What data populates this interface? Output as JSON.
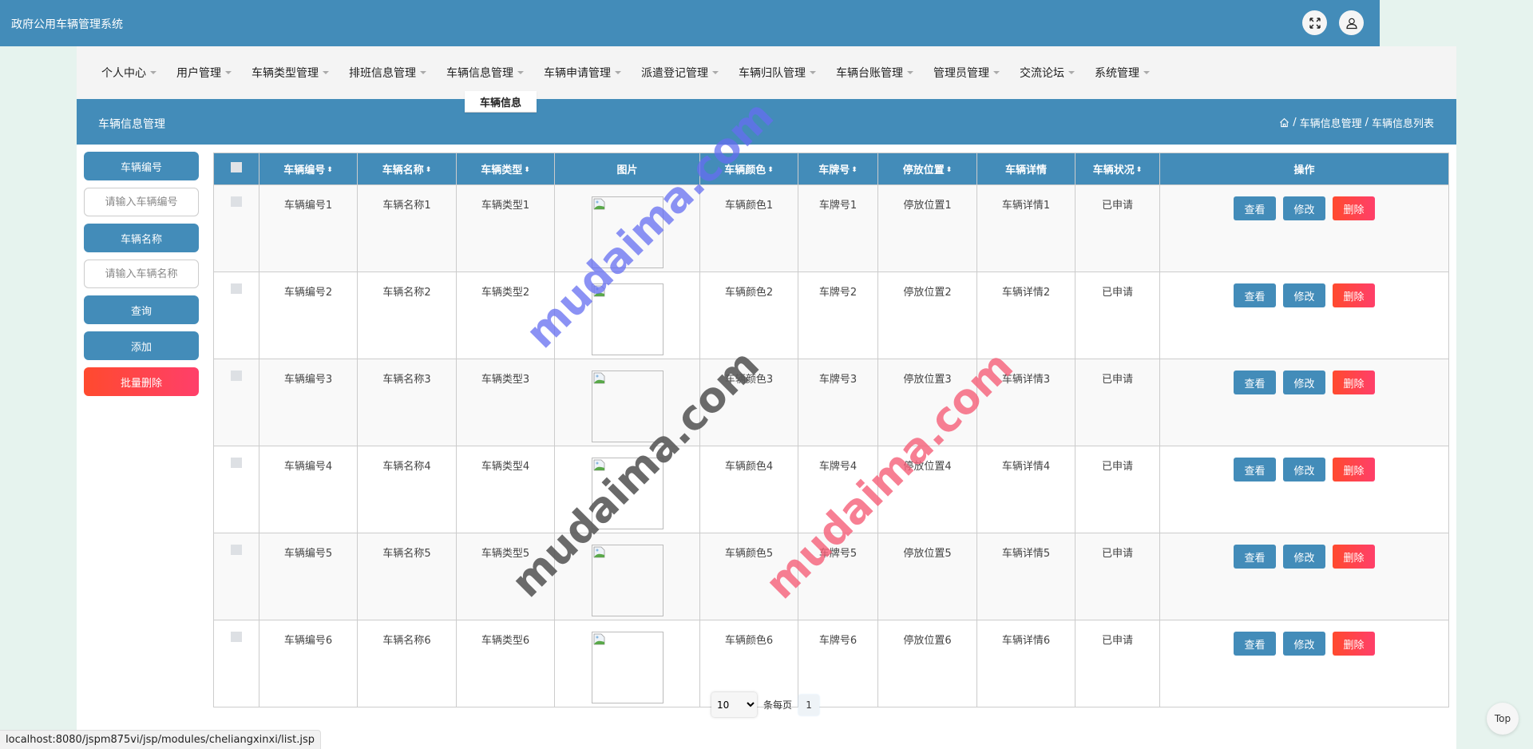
{
  "app": {
    "title": "政府公用车辆管理系统",
    "icons": {
      "fullscreen": "fullscreen-icon",
      "user": "user-icon"
    }
  },
  "nav": {
    "items": [
      {
        "label": "个人中心"
      },
      {
        "label": "用户管理"
      },
      {
        "label": "车辆类型管理"
      },
      {
        "label": "排班信息管理"
      },
      {
        "label": "车辆信息管理"
      },
      {
        "label": "车辆申请管理"
      },
      {
        "label": "派遣登记管理"
      },
      {
        "label": "车辆归队管理"
      },
      {
        "label": "车辆台账管理"
      },
      {
        "label": "管理员管理"
      },
      {
        "label": "交流论坛"
      },
      {
        "label": "系统管理"
      }
    ],
    "open_dropdown": {
      "parent": "车辆信息管理",
      "items": [
        "车辆信息"
      ]
    }
  },
  "band": {
    "page_title": "车辆信息管理",
    "breadcrumb": [
      "车辆信息管理",
      "车辆信息列表"
    ],
    "separator": "/"
  },
  "search": {
    "field1_label": "车辆编号",
    "field1_placeholder": "请输入车辆编号",
    "field1_value": "",
    "field2_label": "车辆名称",
    "field2_placeholder": "请输入车辆名称",
    "field2_value": "",
    "query_label": "查询",
    "add_label": "添加",
    "batch_delete_label": "批量删除"
  },
  "table": {
    "columns": [
      {
        "label": "",
        "type": "checkbox"
      },
      {
        "label": "车辆编号",
        "sortable": true
      },
      {
        "label": "车辆名称",
        "sortable": true
      },
      {
        "label": "车辆类型",
        "sortable": true
      },
      {
        "label": "图片",
        "sortable": false
      },
      {
        "label": "车辆颜色",
        "sortable": true
      },
      {
        "label": "车牌号",
        "sortable": true
      },
      {
        "label": "停放位置",
        "sortable": true
      },
      {
        "label": "车辆详情",
        "sortable": false
      },
      {
        "label": "车辆状况",
        "sortable": true
      },
      {
        "label": "操作",
        "sortable": false
      }
    ],
    "sort_glyph": "⇕",
    "rows": [
      {
        "no": "车辆编号1",
        "name": "车辆名称1",
        "type": "车辆类型1",
        "color": "车辆颜色1",
        "plate": "车牌号1",
        "location": "停放位置1",
        "detail": "车辆详情1",
        "status": "已申请"
      },
      {
        "no": "车辆编号2",
        "name": "车辆名称2",
        "type": "车辆类型2",
        "color": "车辆颜色2",
        "plate": "车牌号2",
        "location": "停放位置2",
        "detail": "车辆详情2",
        "status": "已申请"
      },
      {
        "no": "车辆编号3",
        "name": "车辆名称3",
        "type": "车辆类型3",
        "color": "车辆颜色3",
        "plate": "车牌号3",
        "location": "停放位置3",
        "detail": "车辆详情3",
        "status": "已申请"
      },
      {
        "no": "车辆编号4",
        "name": "车辆名称4",
        "type": "车辆类型4",
        "color": "车辆颜色4",
        "plate": "车牌号4",
        "location": "停放位置4",
        "detail": "车辆详情4",
        "status": "已申请"
      },
      {
        "no": "车辆编号5",
        "name": "车辆名称5",
        "type": "车辆类型5",
        "color": "车辆颜色5",
        "plate": "车牌号5",
        "location": "停放位置5",
        "detail": "车辆详情5",
        "status": "已申请"
      },
      {
        "no": "车辆编号6",
        "name": "车辆名称6",
        "type": "车辆类型6",
        "color": "车辆颜色6",
        "plate": "车牌号6",
        "location": "停放位置6",
        "detail": "车辆详情6",
        "status": "已申请"
      }
    ],
    "actions": {
      "view": "查看",
      "edit": "修改",
      "delete": "删除"
    }
  },
  "pager": {
    "page_size": "10",
    "page_size_options": [
      "10"
    ],
    "per_page_label": "条每页",
    "current_page": "1"
  },
  "status_bar": {
    "url": "localhost:8080/jspm875vi/jsp/modules/cheliangxinxi/list.jsp"
  },
  "top_button": {
    "label": "Top"
  },
  "watermarks": [
    "mudaima.com",
    "mudaima.com",
    "mudaima.com"
  ],
  "colors": {
    "primary": "#438cb9",
    "danger_start": "#ff4a2e",
    "danger_end": "#ff3f6a",
    "page_bg": "#e6f3ee",
    "nav_bg": "#f4f4f4",
    "row_stripe": "#f9f9f9"
  }
}
